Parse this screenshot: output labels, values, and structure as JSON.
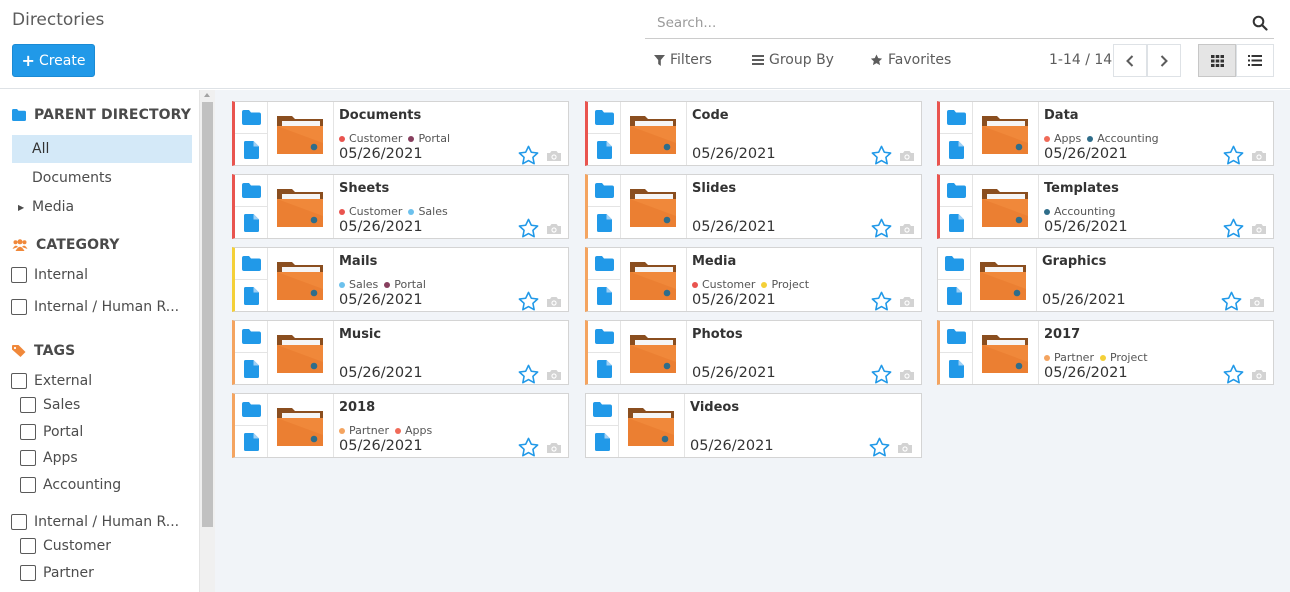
{
  "control_panel": {
    "title": "Directories",
    "create_label": "Create",
    "search_placeholder": "Search...",
    "filters_label": "Filters",
    "group_by_label": "Group By",
    "favorites_label": "Favorites",
    "pager": "1-14 / 14"
  },
  "sidebar": {
    "parent_directory": {
      "header": "PARENT DIRECTORY",
      "items": [
        "All",
        "Documents",
        "Media"
      ]
    },
    "category": {
      "header": "CATEGORY",
      "items": [
        "Internal",
        "Internal / Human R..."
      ]
    },
    "tags": {
      "header": "TAGS",
      "groups": [
        {
          "label": "External",
          "items": [
            "Sales",
            "Portal",
            "Apps",
            "Accounting"
          ]
        },
        {
          "label": "Internal / Human R...",
          "items": [
            "Customer",
            "Partner"
          ]
        }
      ]
    }
  },
  "colors": {
    "accent": "#2199e8",
    "folder_orange": "#f0883a",
    "star": "#2199e8",
    "tag_colors": {
      "Customer": "#e9544f",
      "Portal": "#873f5e",
      "Apps": "#f06a58",
      "Accounting": "#2f6d8a",
      "Sales": "#6cc1ed",
      "Project": "#f4d038",
      "Partner": "#f4a460"
    },
    "border_colors": {
      "red": "#e9544f",
      "yellow": "#f4d038",
      "orange": "#f4a460"
    }
  },
  "directories": [
    {
      "name": "Documents",
      "tags": [
        "Customer",
        "Portal"
      ],
      "date": "05/26/2021",
      "border": "red"
    },
    {
      "name": "Code",
      "tags": [],
      "date": "05/26/2021",
      "border": "red"
    },
    {
      "name": "Data",
      "tags": [
        "Apps",
        "Accounting"
      ],
      "date": "05/26/2021",
      "border": "red"
    },
    {
      "name": "Sheets",
      "tags": [
        "Customer",
        "Sales"
      ],
      "date": "05/26/2021",
      "border": "red"
    },
    {
      "name": "Slides",
      "tags": [],
      "date": "05/26/2021",
      "border": "orange"
    },
    {
      "name": "Templates",
      "tags": [
        "Accounting"
      ],
      "date": "05/26/2021",
      "border": "red"
    },
    {
      "name": "Mails",
      "tags": [
        "Sales",
        "Portal"
      ],
      "date": "05/26/2021",
      "border": "yellow"
    },
    {
      "name": "Media",
      "tags": [
        "Customer",
        "Project"
      ],
      "date": "05/26/2021",
      "border": "orange"
    },
    {
      "name": "Graphics",
      "tags": [],
      "date": "05/26/2021",
      "border": "none"
    },
    {
      "name": "Music",
      "tags": [],
      "date": "05/26/2021",
      "border": "orange"
    },
    {
      "name": "Photos",
      "tags": [],
      "date": "05/26/2021",
      "border": "orange"
    },
    {
      "name": "2017",
      "tags": [
        "Partner",
        "Project"
      ],
      "date": "05/26/2021",
      "border": "orange"
    },
    {
      "name": "2018",
      "tags": [
        "Partner",
        "Apps"
      ],
      "date": "05/26/2021",
      "border": "orange"
    },
    {
      "name": "Videos",
      "tags": [],
      "date": "05/26/2021",
      "border": "none"
    }
  ]
}
